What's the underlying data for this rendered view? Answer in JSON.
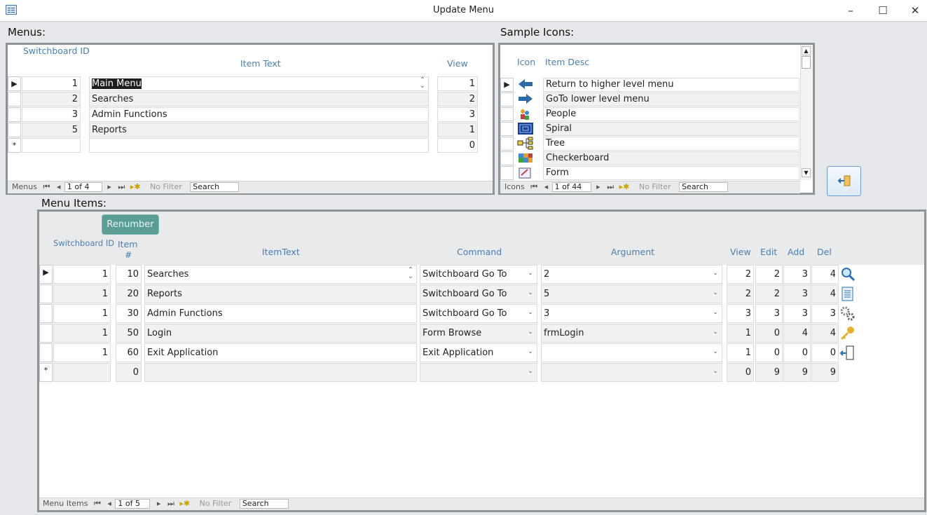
{
  "window": {
    "title": "Update Menu",
    "minimize": "–",
    "maximize": "☐",
    "close": "✕"
  },
  "menus": {
    "label": "Menus:",
    "headers": {
      "switchboard_id": "Switchboard ID",
      "item_text": "Item Text",
      "view": "View"
    },
    "rows": [
      {
        "id": "1",
        "text": "Main Menu",
        "view": "1"
      },
      {
        "id": "2",
        "text": "Searches",
        "view": "2"
      },
      {
        "id": "3",
        "text": "Admin Functions",
        "view": "3"
      },
      {
        "id": "5",
        "text": "Reports",
        "view": "1"
      }
    ],
    "new_row": {
      "marker": "*",
      "view": "0"
    },
    "nav": {
      "label": "Menus",
      "record": "1 of 4",
      "filter": "No Filter",
      "search": "Search"
    }
  },
  "icons": {
    "label": "Sample Icons:",
    "headers": {
      "icon": "Icon",
      "desc": "Item Desc"
    },
    "rows": [
      {
        "icon": "arrow-left-icon",
        "desc": "Return to higher level menu"
      },
      {
        "icon": "arrow-right-icon",
        "desc": "GoTo lower level menu"
      },
      {
        "icon": "people-icon",
        "desc": "People"
      },
      {
        "icon": "spiral-icon",
        "desc": "Spiral"
      },
      {
        "icon": "tree-icon",
        "desc": "Tree"
      },
      {
        "icon": "checkerboard-icon",
        "desc": "Checkerboard"
      },
      {
        "icon": "form-icon",
        "desc": "Form"
      }
    ],
    "nav": {
      "label": "Icons",
      "record": "1 of 44",
      "filter": "No Filter",
      "search": "Search"
    }
  },
  "menu_items": {
    "label": "Menu Items:",
    "renumber": "Renumber",
    "headers": {
      "switchboard_id": "Switchboard ID",
      "item_num_1": "Item",
      "item_num_2": "#",
      "item_text": "ItemText",
      "command": "Command",
      "argument": "Argument",
      "view": "View",
      "edit": "Edit",
      "add": "Add",
      "del": "Del"
    },
    "rows": [
      {
        "sid": "1",
        "num": "10",
        "text": "Searches",
        "command": "Switchboard Go To",
        "argument": "2",
        "view": "2",
        "edit": "2",
        "add": "3",
        "del": "4",
        "icon": "search-icon"
      },
      {
        "sid": "1",
        "num": "20",
        "text": "Reports",
        "command": "Switchboard Go To",
        "argument": "5",
        "view": "2",
        "edit": "2",
        "add": "3",
        "del": "4",
        "icon": "report-icon"
      },
      {
        "sid": "1",
        "num": "30",
        "text": "Admin Functions",
        "command": "Switchboard Go To",
        "argument": "3",
        "view": "3",
        "edit": "3",
        "add": "3",
        "del": "3",
        "icon": "gears-icon"
      },
      {
        "sid": "1",
        "num": "50",
        "text": "Login",
        "command": "Form Browse",
        "argument": "frmLogin",
        "view": "1",
        "edit": "0",
        "add": "4",
        "del": "4",
        "icon": "key-icon"
      },
      {
        "sid": "1",
        "num": "60",
        "text": "Exit Application",
        "command": "Exit Application",
        "argument": "",
        "view": "1",
        "edit": "0",
        "add": "0",
        "del": "0",
        "icon": "exit-door-icon"
      }
    ],
    "new_row": {
      "marker": "*",
      "num": "0",
      "view": "0",
      "edit": "9",
      "add": "9",
      "del": "9"
    },
    "nav": {
      "label": "Menu Items",
      "record": "1 of 5",
      "filter": "No Filter",
      "search": "Search"
    }
  },
  "colors": {
    "header_text": "#4a7fb0",
    "panel_border": "#8d9599",
    "renumber_bg": "#5a9c96"
  }
}
